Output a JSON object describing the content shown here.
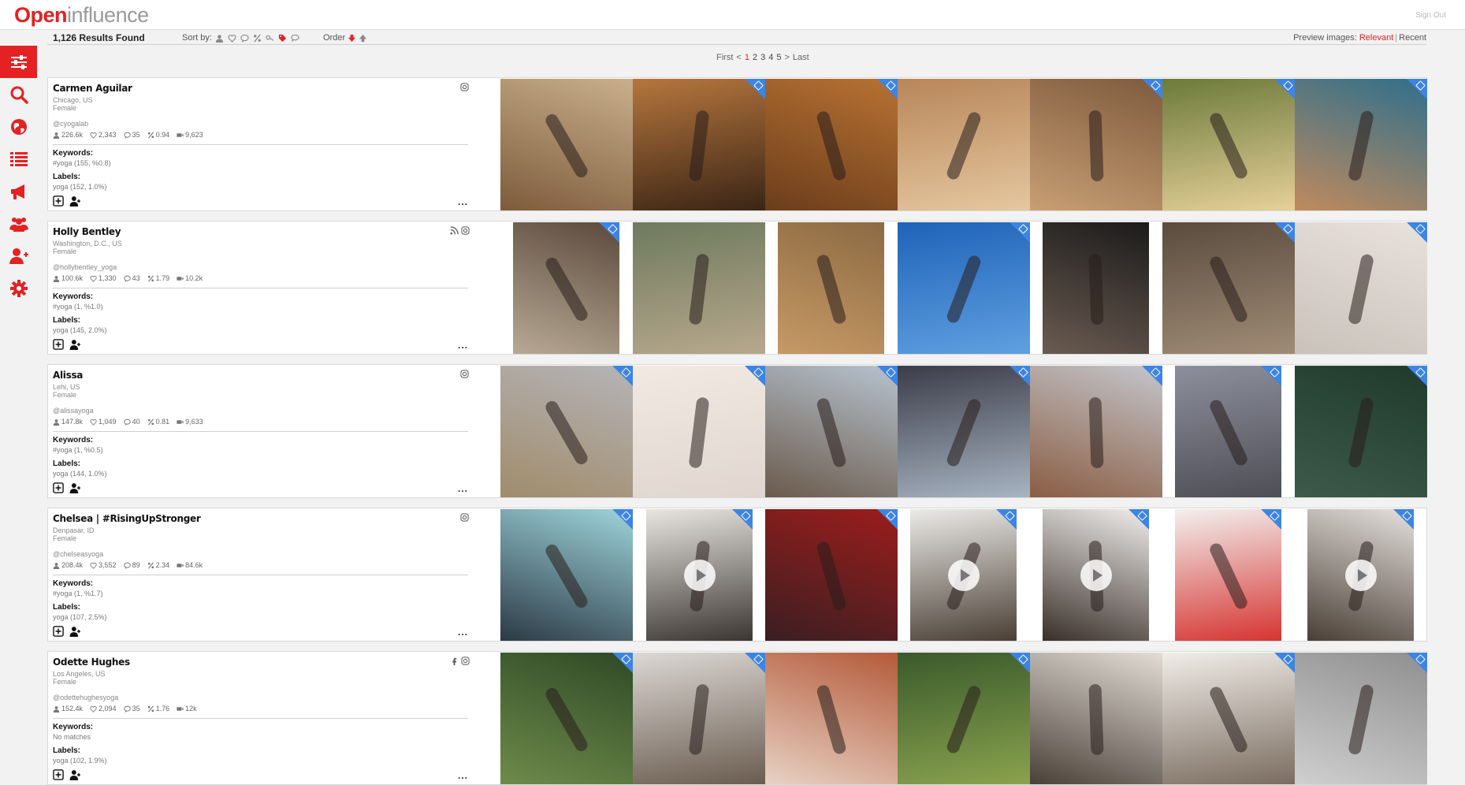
{
  "header": {
    "logo_open": "Open",
    "logo_influence": "influence",
    "sign_out": "Sign Out"
  },
  "sidebar": {
    "items": [
      {
        "icon": "sliders-icon",
        "active": true
      },
      {
        "icon": "search-icon",
        "active": false
      },
      {
        "icon": "globe-icon",
        "active": false
      },
      {
        "icon": "list-icon",
        "active": false
      },
      {
        "icon": "megaphone-icon",
        "active": false
      },
      {
        "icon": "users-icon",
        "active": false
      },
      {
        "icon": "user-plus-icon",
        "active": false
      },
      {
        "icon": "gear-icon",
        "active": false
      }
    ]
  },
  "results": {
    "count": "1,126 Results Found",
    "sort_label": "Sort by:",
    "order_label": "Order",
    "preview_label": "Preview images:",
    "preview_relevant": "Relevant",
    "preview_sep": "|",
    "preview_recent": "Recent"
  },
  "pager": {
    "first": "First",
    "prev": "<",
    "pages": [
      "1",
      "2",
      "3",
      "4",
      "5"
    ],
    "current": "1",
    "next": ">",
    "last": "Last"
  },
  "accent_color": "#e42123",
  "tag_color": "#3d84e4",
  "influencers": [
    {
      "name": "Carmen Aguilar",
      "location": "Chicago, US",
      "gender": "Female",
      "handle": "@cyogalab",
      "followers": "226.6k",
      "likes": "2,343",
      "comments": "35",
      "engagement": "0.94",
      "views": "9,623",
      "keywords_label": "Keywords:",
      "keywords": "#yoga (155, %0.8)",
      "labels_label": "Labels:",
      "labels": "yoga (152, 1.0%)",
      "more": "...",
      "social": [
        "instagram-icon"
      ]
    },
    {
      "name": "Holly Bentley",
      "location": "Washington, D.C., US",
      "gender": "Female",
      "handle": "@hollybentley_yoga",
      "followers": "100.6k",
      "likes": "1,330",
      "comments": "43",
      "engagement": "1.79",
      "views": "10.2k",
      "keywords_label": "Keywords:",
      "keywords": "#yoga (1, %1.0)",
      "labels_label": "Labels:",
      "labels": "yoga (145, 2.0%)",
      "more": "...",
      "social": [
        "rss-icon",
        "instagram-icon"
      ]
    },
    {
      "name": "Alissa",
      "location": "Lehi, US",
      "gender": "Female",
      "handle": "@alissayoga",
      "followers": "147.8k",
      "likes": "1,049",
      "comments": "40",
      "engagement": "0.81",
      "views": "9,633",
      "keywords_label": "Keywords:",
      "keywords": "#yoga (1, %0.5)",
      "labels_label": "Labels:",
      "labels": "yoga (144, 1.0%)",
      "more": "...",
      "social": [
        "instagram-icon"
      ]
    },
    {
      "name": "Chelsea | #RisingUpStronger",
      "location": "Denpasar, ID",
      "gender": "Female",
      "handle": "@chelseasyoga",
      "followers": "208.4k",
      "likes": "3,552",
      "comments": "89",
      "engagement": "2.34",
      "views": "84.6k",
      "keywords_label": "Keywords:",
      "keywords": "#yoga (1, %1.7)",
      "labels_label": "Labels:",
      "labels": "yoga (107, 2.5%)",
      "more": "...",
      "social": [
        "instagram-icon"
      ]
    },
    {
      "name": "Odette Hughes",
      "location": "Los Angeles, US",
      "gender": "Female",
      "handle": "@odettehughesyoga",
      "followers": "152.4k",
      "likes": "2,094",
      "comments": "35",
      "engagement": "1.76",
      "views": "12k",
      "keywords_label": "Keywords:",
      "keywords": "No matches",
      "labels_label": "Labels:",
      "labels": "yoga (102, 1.9%)",
      "more": "...",
      "social": [
        "facebook-icon",
        "instagram-icon"
      ]
    }
  ]
}
